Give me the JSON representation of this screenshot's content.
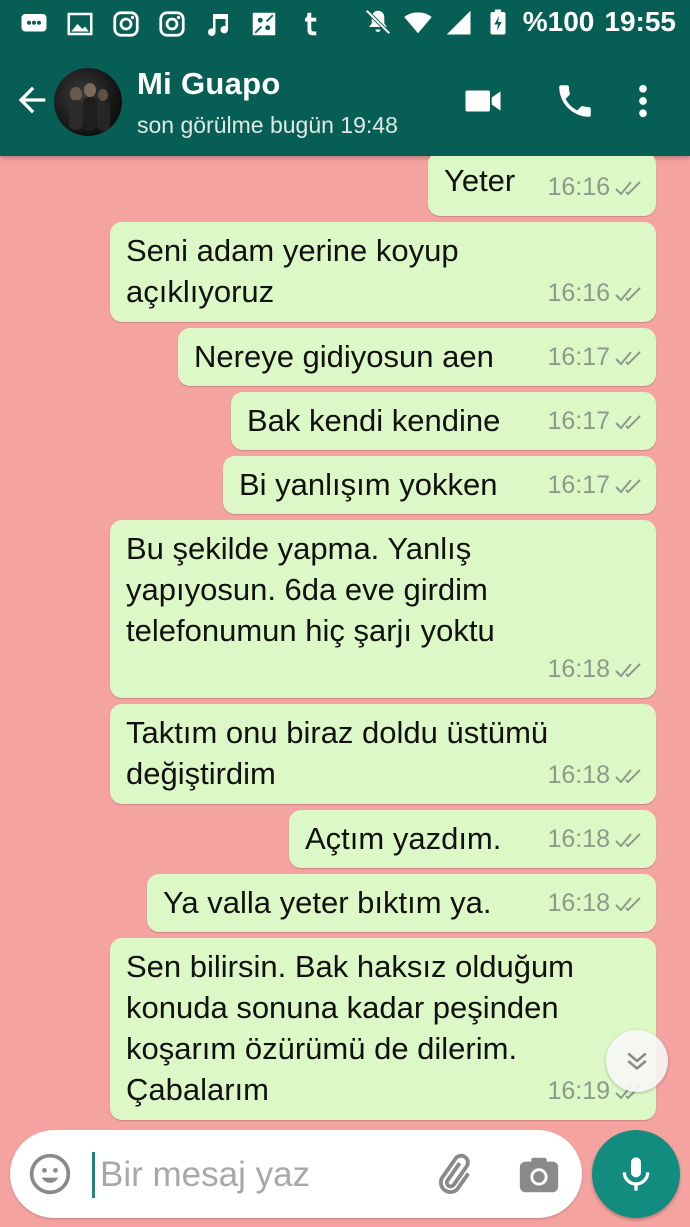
{
  "status_bar": {
    "battery": "%100",
    "time": "19:55",
    "notification_icons": [
      "messages-icon",
      "gallery-icon",
      "instagram-icon",
      "instagram-icon",
      "music-icon",
      "game-icon",
      "tumblr-icon"
    ]
  },
  "header": {
    "contact_name": "Mi Guapo",
    "last_seen": "son görülme bugün 19:48"
  },
  "messages": [
    {
      "text": "Yeter",
      "time": "16:16"
    },
    {
      "text": "Seni adam yerine koyup\naçıklıyoruz",
      "time": "16:16"
    },
    {
      "text": "Nereye gidiyosun aen",
      "time": "16:17"
    },
    {
      "text": "Bak kendi kendine",
      "time": "16:17"
    },
    {
      "text": "Bi yanlışım yokken",
      "time": "16:17"
    },
    {
      "text": "Bu şekilde yapma. Yanlış\nyapıyosun. 6da eve girdim\ntelefonumun hiç şarjı yoktu",
      "time": "16:18"
    },
    {
      "text": "Taktım onu biraz doldu üstümü\ndeğiştirdim",
      "time": "16:18"
    },
    {
      "text": "Açtım yazdım.",
      "time": "16:18"
    },
    {
      "text": "Ya valla yeter bıktım ya.",
      "time": "16:18"
    },
    {
      "text": "Sen bilirsin. Bak haksız olduğum\nkonuda sonuna kadar peşinden\nkoşarım özürümü de dilerim.\nÇabalarım",
      "time": "16:19"
    }
  ],
  "composer": {
    "placeholder": "Bir mesaj yaz",
    "value": ""
  },
  "colors": {
    "primary": "#075e54",
    "accent": "#128c7e",
    "bubble": "#dcf8c6",
    "wallpaper": "#f4a3a0"
  }
}
